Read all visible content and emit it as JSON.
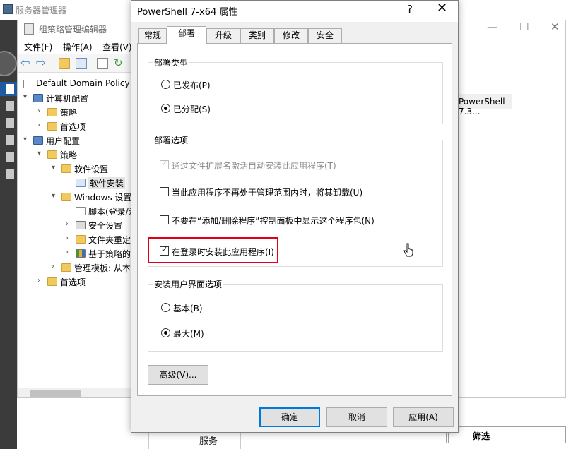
{
  "server_manager": {
    "title": "服务器管理器",
    "bottom_label": "服务",
    "filter_label": "筛选"
  },
  "gpo_editor": {
    "title": "组策略管理编辑器",
    "menu": [
      "文件(F)",
      "操作(A)",
      "查看(V)"
    ],
    "right_row": "PowerShell-7.3...",
    "tree": [
      {
        "label": "Default Domain Policy",
        "icon": "policy-icon",
        "toggle": ""
      },
      {
        "label": "计算机配置",
        "icon": "computer-icon",
        "toggle": "▾"
      },
      {
        "label": "策略",
        "icon": "folder-icon",
        "toggle": "›"
      },
      {
        "label": "首选项",
        "icon": "folder-icon",
        "toggle": "›"
      },
      {
        "label": "用户配置",
        "icon": "user-icon",
        "toggle": "▾"
      },
      {
        "label": "策略",
        "icon": "folder-icon",
        "toggle": "▾"
      },
      {
        "label": "软件设置",
        "icon": "folder-icon",
        "toggle": "▾"
      },
      {
        "label": "软件安装",
        "icon": "package-icon",
        "toggle": ""
      },
      {
        "label": "Windows 设置",
        "icon": "folder-icon",
        "toggle": "▾"
      },
      {
        "label": "脚本(登录/注",
        "icon": "script-icon",
        "toggle": ""
      },
      {
        "label": "安全设置",
        "icon": "lock-icon",
        "toggle": "›"
      },
      {
        "label": "文件夹重定",
        "icon": "folder-icon",
        "toggle": "›"
      },
      {
        "label": "基于策略的",
        "icon": "chart-icon",
        "toggle": "›"
      },
      {
        "label": "管理模板: 从本",
        "icon": "folder-icon",
        "toggle": "›"
      },
      {
        "label": "首选项",
        "icon": "folder-icon",
        "toggle": "›"
      }
    ]
  },
  "dialog": {
    "title": "PowerShell 7-x64 属性",
    "help": "?",
    "close": "✕",
    "tabs": [
      "常规",
      "部署",
      "升级",
      "类别",
      "修改",
      "安全"
    ],
    "active_tab": "部署",
    "deploy_type": {
      "caption": "部署类型",
      "published": "已发布(P)",
      "assigned": "已分配(S)"
    },
    "deploy_options": {
      "caption": "部署选项",
      "auto_install_ext": "通过文件扩展名激活自动安装此应用程序(T)",
      "uninstall_out_of_scope": "当此应用程序不再处于管理范围内时，将其卸载(U)",
      "hide_in_arp": "不要在“添加/删除程序”控制面板中显示这个程序包(N)",
      "install_at_logon": "在登录时安装此应用程序(I)"
    },
    "ui_options": {
      "caption": "安装用户界面选项",
      "basic": "基本(B)",
      "maximum": "最大(M)"
    },
    "advanced_button": "高级(V)...",
    "ok": "确定",
    "cancel": "取消",
    "apply": "应用(A)"
  },
  "colors": {
    "highlight": "#e0001b",
    "default_button_border": "#0078d7"
  }
}
